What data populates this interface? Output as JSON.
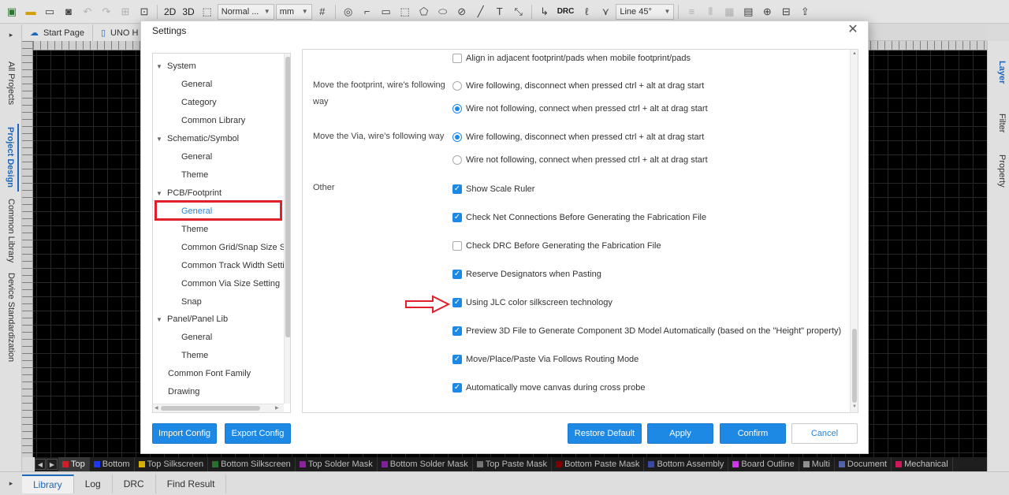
{
  "toolbar": {
    "mode_2d": "2D",
    "mode_3d": "3D",
    "line_style": "Normal ...",
    "unit": "mm",
    "drc": "DRC",
    "route_angle": "Line 45°"
  },
  "left_rail": {
    "tabs": [
      "All Projects",
      "Project Design",
      "Common Library",
      "Device Standardization"
    ]
  },
  "right_rail": {
    "tabs": [
      "Layer",
      "Filter",
      "Property"
    ]
  },
  "doc_tabs": [
    "Start Page",
    "UNO H"
  ],
  "layers": [
    {
      "name": "Top",
      "color": "#e0202a"
    },
    {
      "name": "Bottom",
      "color": "#1e3cff"
    },
    {
      "name": "Top Silkscreen",
      "color": "#e8c000"
    },
    {
      "name": "Bottom Silkscreen",
      "color": "#2e7d32"
    },
    {
      "name": "Top Solder Mask",
      "color": "#9c27b0"
    },
    {
      "name": "Bottom Solder Mask",
      "color": "#8e24aa"
    },
    {
      "name": "Top Paste Mask",
      "color": "#808080"
    },
    {
      "name": "Bottom Paste Mask",
      "color": "#8b0000"
    },
    {
      "name": "Bottom Assembly",
      "color": "#3f51b5"
    },
    {
      "name": "Board Outline",
      "color": "#e040fb"
    },
    {
      "name": "Multi",
      "color": "#9e9e9e"
    },
    {
      "name": "Document",
      "color": "#5c6bc0"
    },
    {
      "name": "Mechanical",
      "color": "#d81b60"
    }
  ],
  "bottom_tabs": [
    "Library",
    "Log",
    "DRC",
    "Find Result"
  ],
  "dialog": {
    "title": "Settings",
    "tree": [
      {
        "label": "System",
        "level": 0,
        "expanded": true
      },
      {
        "label": "General",
        "level": 1
      },
      {
        "label": "Category",
        "level": 1
      },
      {
        "label": "Common Library",
        "level": 1
      },
      {
        "label": "Schematic/Symbol",
        "level": 0,
        "expanded": true
      },
      {
        "label": "General",
        "level": 1
      },
      {
        "label": "Theme",
        "level": 1
      },
      {
        "label": "PCB/Footprint",
        "level": 0,
        "expanded": true
      },
      {
        "label": "General",
        "level": 1,
        "selected": true
      },
      {
        "label": "Theme",
        "level": 1
      },
      {
        "label": "Common Grid/Snap Size Se",
        "level": 1
      },
      {
        "label": "Common Track Width Settin",
        "level": 1
      },
      {
        "label": "Common Via Size Setting",
        "level": 1
      },
      {
        "label": "Snap",
        "level": 1
      },
      {
        "label": "Panel/Panel Lib",
        "level": 0,
        "expanded": true
      },
      {
        "label": "General",
        "level": 1
      },
      {
        "label": "Theme",
        "level": 1
      },
      {
        "label": "Common Font Family",
        "level": 0,
        "leaf": true
      },
      {
        "label": "Drawing",
        "level": 0,
        "leaf": true
      }
    ],
    "content": {
      "align_option": "Align in adjacent footprint/pads when mobile footprint/pads",
      "footprint_label": "Move the footprint, wire's following way",
      "footprint_opt1": "Wire following, disconnect when pressed ctrl + alt at drag start",
      "footprint_opt2": "Wire not following, connect when pressed ctrl + alt at drag start",
      "via_label": "Move the Via, wire's following way",
      "via_opt1": "Wire following, disconnect when pressed ctrl + alt at drag start",
      "via_opt2": "Wire not following, connect when pressed ctrl + alt at drag start",
      "other_label": "Other",
      "other_options": [
        {
          "label": "Show Scale Ruler",
          "checked": true
        },
        {
          "label": "Check Net Connections Before Generating the Fabrication File",
          "checked": true
        },
        {
          "label": "Check DRC Before Generating the Fabrication File",
          "checked": false
        },
        {
          "label": "Reserve Designators when Pasting",
          "checked": true
        },
        {
          "label": "Using JLC color silkscreen technology",
          "checked": true
        },
        {
          "label": "Preview 3D File to Generate Component 3D Model Automatically (based on the \"Height\" property)",
          "checked": true
        },
        {
          "label": "Move/Place/Paste Via Follows Routing Mode",
          "checked": true
        },
        {
          "label": "Automatically move canvas during cross probe",
          "checked": true
        }
      ]
    },
    "buttons": {
      "import": "Import Config",
      "export": "Export Config",
      "restore": "Restore Default",
      "apply": "Apply",
      "confirm": "Confirm",
      "cancel": "Cancel"
    }
  }
}
